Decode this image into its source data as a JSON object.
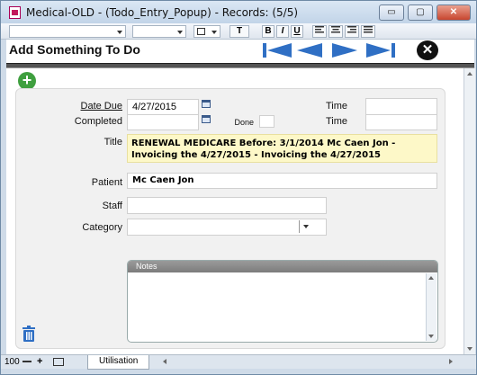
{
  "window": {
    "title": "Medical-OLD - (Todo_Entry_Popup) - Records: (5/5)",
    "minimize_label": "▭",
    "maximize_label": "▢",
    "close_label": "✕"
  },
  "toolbar": {
    "bold": "B",
    "italic": "I",
    "underline": "U",
    "text_tool": "T"
  },
  "header": {
    "page_title": "Add Something To Do"
  },
  "form": {
    "date_due_label": "Date Due",
    "date_due_value": "4/27/2015",
    "completed_label": "Completed",
    "completed_value": "",
    "done_label": "Done",
    "time_label": "Time",
    "time_value": "",
    "time2_label": "Time",
    "time2_value": "",
    "title_label": "Title",
    "title_value": "RENEWAL MEDICARE Before: 3/1/2014 Mc Caen  Jon - Invoicing the 4/27/2015 - Invoicing the 4/27/2015",
    "patient_label": "Patient",
    "patient_value": "Mc Caen  Jon",
    "staff_label": "Staff",
    "staff_value": "",
    "category_label": "Category",
    "category_value": "",
    "notes_label": "Notes",
    "notes_value": ""
  },
  "statusbar": {
    "zoom": "100",
    "tab_label": "Utilisation"
  }
}
